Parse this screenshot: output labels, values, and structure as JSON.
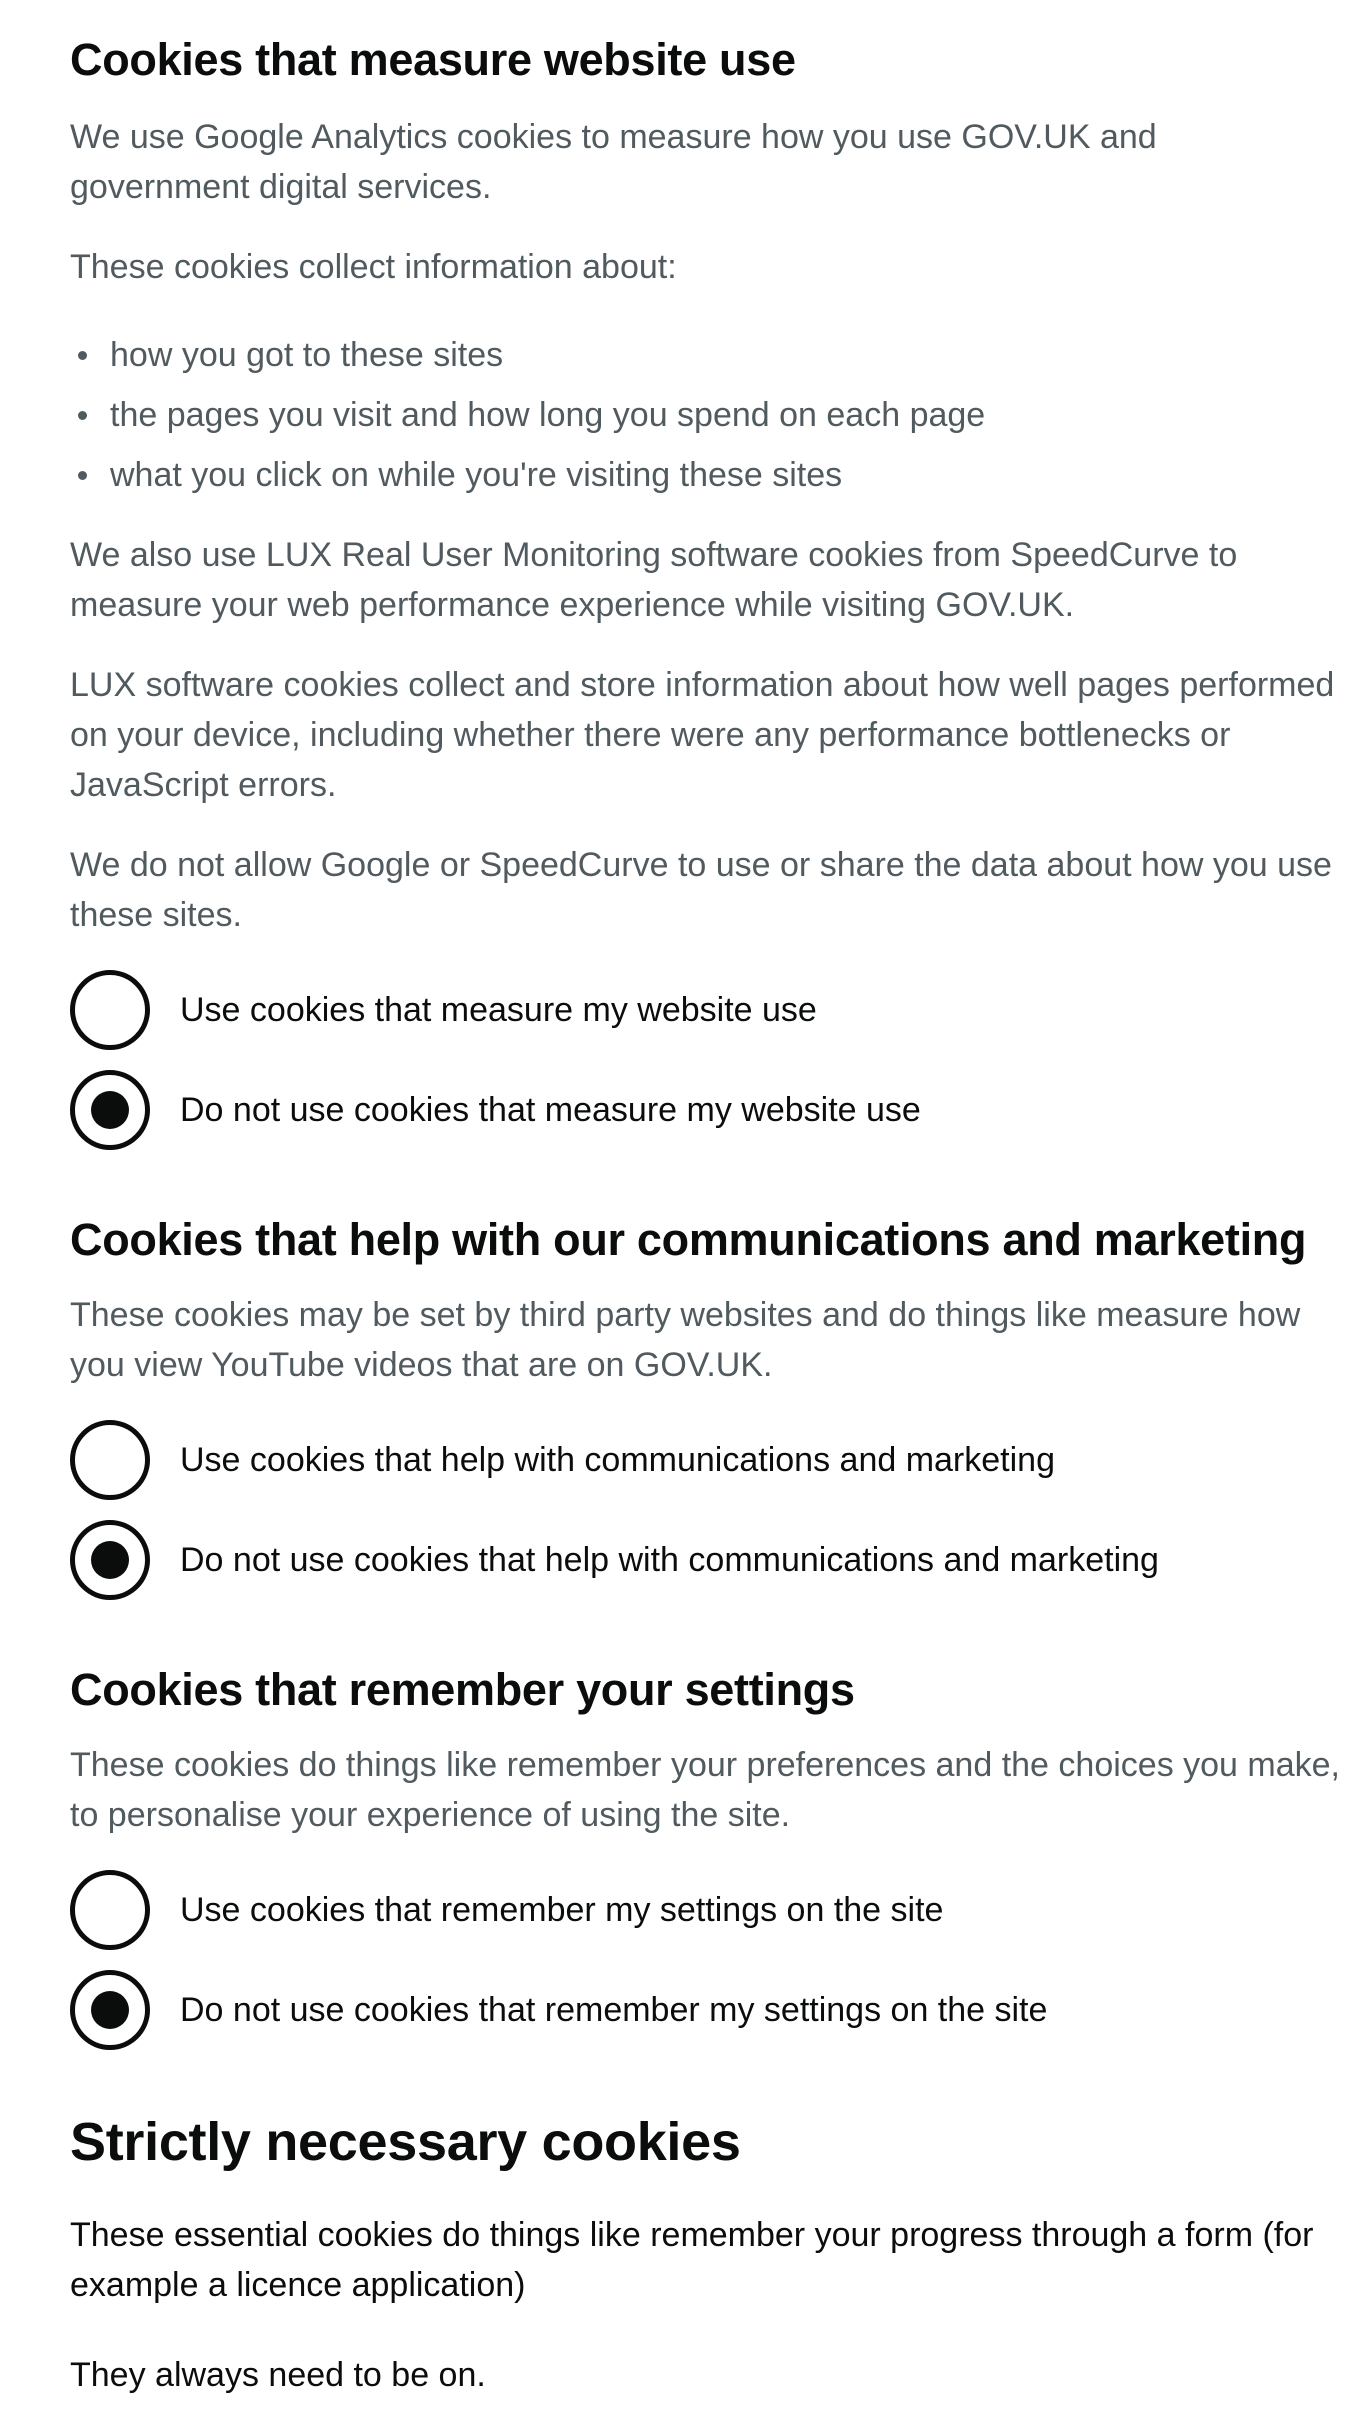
{
  "measure": {
    "heading": "Cookies that measure website use",
    "intro": "We use Google Analytics cookies to measure how you use GOV.UK and government digital services.",
    "collect_intro": "These cookies collect information about:",
    "bullets": [
      "how you got to these sites",
      "the pages you visit and how long you spend on each page",
      "what you click on while you're visiting these sites"
    ],
    "lux_para": "We also use LUX Real User Monitoring software cookies from SpeedCurve to measure your web performance experience while visiting GOV.UK.",
    "lux_collect": "LUX software cookies collect and store information about how well pages performed on your device, including whether there were any performance bottlenecks or JavaScript errors.",
    "no_share": "We do not allow Google or SpeedCurve to use or share the data about how you use these sites.",
    "option_yes": "Use cookies that measure my website use",
    "option_no": "Do not use cookies that measure my website use",
    "selected": "no"
  },
  "marketing": {
    "heading": "Cookies that help with our communications and marketing",
    "intro": "These cookies may be set by third party websites and do things like measure how you view YouTube videos that are on GOV.UK.",
    "option_yes": "Use cookies that help with communications and marketing",
    "option_no": "Do not use cookies that help with communications and marketing",
    "selected": "no"
  },
  "settings": {
    "heading": "Cookies that remember your settings",
    "intro": "These cookies do things like remember your preferences and the choices you make, to personalise your experience of using the site.",
    "option_yes": "Use cookies that remember my settings on the site",
    "option_no": "Do not use cookies that remember my settings on the site",
    "selected": "no"
  },
  "necessary": {
    "heading": "Strictly necessary cookies",
    "intro": "These essential cookies do things like remember your progress through a form (for example a licence application)",
    "always_on": "They always need to be on."
  }
}
